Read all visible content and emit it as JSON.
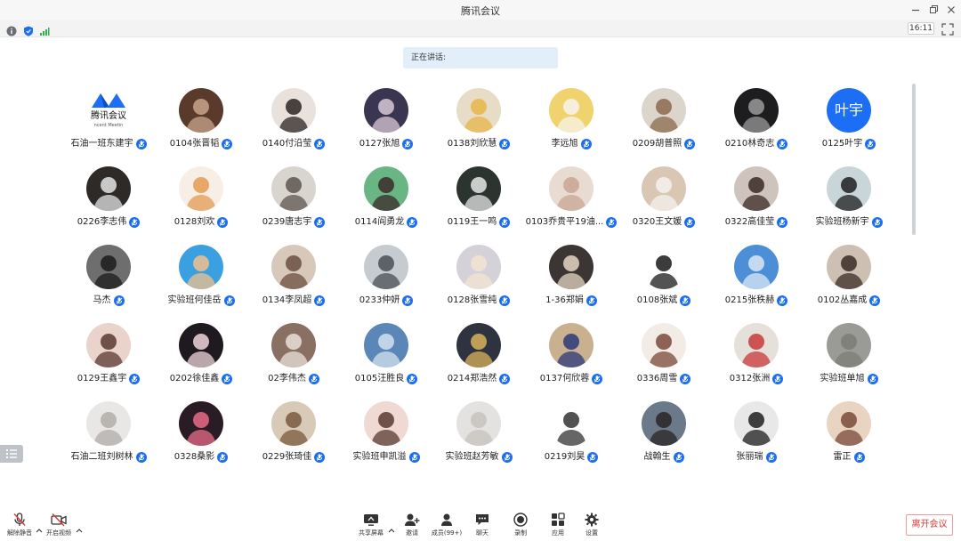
{
  "app": {
    "title": "腾讯会议",
    "clock": "16:11"
  },
  "speaking": {
    "label": "正在讲话:"
  },
  "colors": {
    "accent": "#1c6ff4",
    "leave": "#d23b3b",
    "mic": "#1c6ff4"
  },
  "participants": [
    {
      "name": "石油一班东建宇",
      "avatar": "logo",
      "logo_text": "腾讯会议",
      "logo_sub": "ncent Meetin"
    },
    {
      "name": "0104张晋韬",
      "avatar": "photo",
      "bg": "#5a3a2a",
      "fg": "#caa58c"
    },
    {
      "name": "0140付沿莹",
      "avatar": "photo",
      "bg": "#e9e2dc",
      "fg": "#2b2422"
    },
    {
      "name": "0127张旭",
      "avatar": "photo",
      "bg": "#3a3550",
      "fg": "#d9c8d6"
    },
    {
      "name": "0138刘欣慧",
      "avatar": "photo",
      "bg": "#e7dcc6",
      "fg": "#e7b64a"
    },
    {
      "name": "李远旭",
      "avatar": "photo",
      "bg": "#f1d36e",
      "fg": "#f6f3ee"
    },
    {
      "name": "0209胡普照",
      "avatar": "photo",
      "bg": "#dcd5cc",
      "fg": "#8b6a4b"
    },
    {
      "name": "0210林奇志",
      "avatar": "photo",
      "bg": "#1d1d1f",
      "fg": "#9a9a9a"
    },
    {
      "name": "0125叶宇",
      "avatar": "text",
      "text": "叶宇",
      "bg": "#1c6ff4"
    },
    {
      "name": "0226李志伟",
      "avatar": "photo",
      "bg": "#2d2a28",
      "fg": "#e4e4e4"
    },
    {
      "name": "0128刘欢",
      "avatar": "photo",
      "bg": "#f7efe6",
      "fg": "#e39a52"
    },
    {
      "name": "0239唐志宇",
      "avatar": "photo",
      "bg": "#d8d4ce",
      "fg": "#5e5650"
    },
    {
      "name": "0114阎勇龙",
      "avatar": "photo",
      "bg": "#69b684",
      "fg": "#3b2a2a"
    },
    {
      "name": "0119王一鸣",
      "avatar": "photo",
      "bg": "#2c3430",
      "fg": "#e6e6e6"
    },
    {
      "name": "0103乔贵平19油...",
      "avatar": "photo",
      "bg": "#e8dbd2",
      "fg": "#c9a594"
    },
    {
      "name": "0320王文媛",
      "avatar": "photo",
      "bg": "#d9c6b3",
      "fg": "#f4f1ee"
    },
    {
      "name": "0322高佳莹",
      "avatar": "photo",
      "bg": "#cfc3bd",
      "fg": "#3a2a26"
    },
    {
      "name": "实验班杨新宇",
      "avatar": "photo",
      "bg": "#c9d6d9",
      "fg": "#1e1e1e"
    },
    {
      "name": "马杰",
      "avatar": "photo",
      "bg": "#6e6e6e",
      "fg": "#1c1c1c"
    },
    {
      "name": "实验班何佳岳",
      "avatar": "photo",
      "bg": "#3aa0df",
      "fg": "#f2c08e"
    },
    {
      "name": "0134李凤超",
      "avatar": "photo",
      "bg": "#d7c8ba",
      "fg": "#6b4f3e"
    },
    {
      "name": "0233仲妍",
      "avatar": "photo",
      "bg": "#c6cbd0",
      "fg": "#4a4f56"
    },
    {
      "name": "0128张雪纯",
      "avatar": "photo",
      "bg": "#d4d2d8",
      "fg": "#f3e4d0"
    },
    {
      "name": "1-36郑娟",
      "avatar": "photo",
      "bg": "#3b3533",
      "fg": "#e6d5c3"
    },
    {
      "name": "0108张斌",
      "avatar": "photo",
      "bg": "#ffffff",
      "fg": "#1a1a1a"
    },
    {
      "name": "0215张秩赫",
      "avatar": "photo",
      "bg": "#4d8fd6",
      "fg": "#dbe8f5"
    },
    {
      "name": "0102丛嘉成",
      "avatar": "photo",
      "bg": "#cdbfb2",
      "fg": "#3a2c24"
    },
    {
      "name": "0129王鑫宇",
      "avatar": "photo",
      "bg": "#e9d3cb",
      "fg": "#5a3a33"
    },
    {
      "name": "0202徐佳鑫",
      "avatar": "photo",
      "bg": "#1f1a1f",
      "fg": "#f0d5dc"
    },
    {
      "name": "02李伟杰",
      "avatar": "photo",
      "bg": "#8a6f63",
      "fg": "#e9e1d8"
    },
    {
      "name": "0105汪胜良",
      "avatar": "photo",
      "bg": "#5a86b8",
      "fg": "#d4e2ee"
    },
    {
      "name": "0214郑浩然",
      "avatar": "photo",
      "bg": "#2f3340",
      "fg": "#d8b35a"
    },
    {
      "name": "0137何欣蓉",
      "avatar": "photo",
      "bg": "#c9b08e",
      "fg": "#2b3a7a"
    },
    {
      "name": "0336周雪",
      "avatar": "photo",
      "bg": "#f3ece6",
      "fg": "#7a4a3a"
    },
    {
      "name": "0312张洲",
      "avatar": "photo",
      "bg": "#e6e0da",
      "fg": "#c83a3a"
    },
    {
      "name": "实验班单旭",
      "avatar": "photo",
      "bg": "#9a9a96",
      "fg": "#7d7d78"
    },
    {
      "name": "石油二班刘树林",
      "avatar": "photo",
      "bg": "#e9e7e5",
      "fg": "#b0aca8"
    },
    {
      "name": "0328桑影",
      "avatar": "photo",
      "bg": "#2a1c24",
      "fg": "#e96a8a"
    },
    {
      "name": "0229张琦佳",
      "avatar": "photo",
      "bg": "#d9cab8",
      "fg": "#7a5a3e"
    },
    {
      "name": "实验班申凯溢",
      "avatar": "photo",
      "bg": "#f0d9d2",
      "fg": "#5a3a32"
    },
    {
      "name": "实验班赵芳敏",
      "avatar": "photo",
      "bg": "#e4e2e0",
      "fg": "#c7c2bd"
    },
    {
      "name": "0219刘昊",
      "avatar": "photo",
      "bg": "#ffffff",
      "fg": "#333333"
    },
    {
      "name": "战翰生",
      "avatar": "photo",
      "bg": "#6b7a8a",
      "fg": "#2a2624"
    },
    {
      "name": "张丽瑞",
      "avatar": "photo",
      "bg": "#e8e8e8",
      "fg": "#1e1e1e"
    },
    {
      "name": "雷正",
      "avatar": "photo",
      "bg": "#e9d4c2",
      "fg": "#7a4a3a"
    }
  ],
  "toolbar": {
    "left": [
      {
        "label": "解除静音",
        "icon": "mic-muted-icon",
        "caret": true
      },
      {
        "label": "开启视频",
        "icon": "camera-off-icon",
        "caret": true
      }
    ],
    "center": [
      {
        "label": "共享屏幕",
        "icon": "share-screen-icon",
        "caret": true
      },
      {
        "label": "邀请",
        "icon": "invite-icon"
      },
      {
        "label": "成员(99+)",
        "icon": "members-icon"
      },
      {
        "label": "聊天",
        "icon": "chat-icon"
      },
      {
        "label": "录制",
        "icon": "record-icon"
      },
      {
        "label": "应用",
        "icon": "apps-icon"
      },
      {
        "label": "设置",
        "icon": "settings-icon"
      }
    ],
    "leave_label": "离开会议"
  }
}
